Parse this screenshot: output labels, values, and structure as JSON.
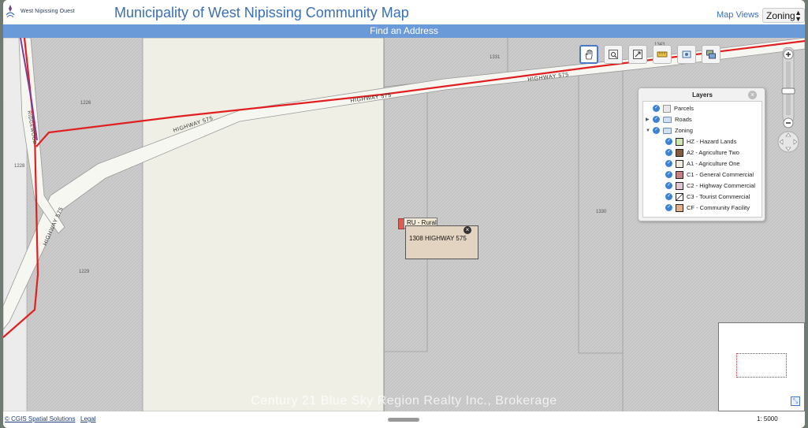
{
  "header": {
    "brand": "West Nipissing Ouest",
    "title": "Municipality of West Nipissing Community Map",
    "map_views_label": "Map Views",
    "zoning_select_value": "Zoning"
  },
  "find_bar": {
    "label": "Find an Address"
  },
  "map": {
    "parcel_labels": [
      "1226",
      "1228",
      "1229",
      "1331",
      "1330",
      "1343"
    ],
    "road_labels": [
      "HIGHWAY 575",
      "HIGHWAY 575",
      "HIGHWAY 575",
      "HIGHWAY 575",
      "RIDGEWOOD"
    ],
    "watermark": "Century 21 Blue Sky Region Realty Inc., Brokerage",
    "colors": {
      "road_red": "#e02020",
      "road_purple": "#7a3ea0",
      "parcel_fill": "#f0efe6",
      "hatched_fill": "#c9c9c9"
    }
  },
  "toolbar": {
    "tools": [
      {
        "icon": "pan-hand-icon",
        "active": true
      },
      {
        "icon": "zoom-box-icon",
        "active": false
      },
      {
        "icon": "full-extent-icon",
        "active": false
      },
      {
        "icon": "measure-icon",
        "active": false
      },
      {
        "icon": "identify-icon",
        "active": false
      },
      {
        "icon": "layers-icon",
        "active": false
      }
    ]
  },
  "layers_panel": {
    "title": "Layers",
    "items": [
      {
        "label": "Parcels",
        "level": 0,
        "kind": "swatch",
        "color": "#e8e8e8"
      },
      {
        "label": "Roads",
        "level": 0,
        "kind": "folder"
      },
      {
        "label": "Zoning",
        "level": 0,
        "kind": "folder-open"
      },
      {
        "label": "HZ - Hazard Lands",
        "level": 1,
        "kind": "swatch",
        "color": "#cfe6b5"
      },
      {
        "label": "A2 - Agriculture Two",
        "level": 1,
        "kind": "swatch",
        "color": "#8b5a3c"
      },
      {
        "label": "A1 - Agriculture One",
        "level": 1,
        "kind": "swatch",
        "color": "#f3e9dd"
      },
      {
        "label": "C1 - General Commercial",
        "level": 1,
        "kind": "swatch",
        "color": "#c78080"
      },
      {
        "label": "C2 - Highway Commercial",
        "level": 1,
        "kind": "swatch",
        "color": "#e2c6d6"
      },
      {
        "label": "C3 - Tourist Commercial",
        "level": 1,
        "kind": "swatch",
        "color": "#ffffff"
      },
      {
        "label": "CF - Community Facility",
        "level": 1,
        "kind": "swatch",
        "color": "#e3b089"
      }
    ]
  },
  "popup": {
    "zone_label": "RU - Rural",
    "address": "1308 HIGHWAY 575"
  },
  "footer": {
    "credit": "© CGIS Spatial Solutions",
    "legal": "Legal",
    "scale_label": "1: 5000"
  }
}
